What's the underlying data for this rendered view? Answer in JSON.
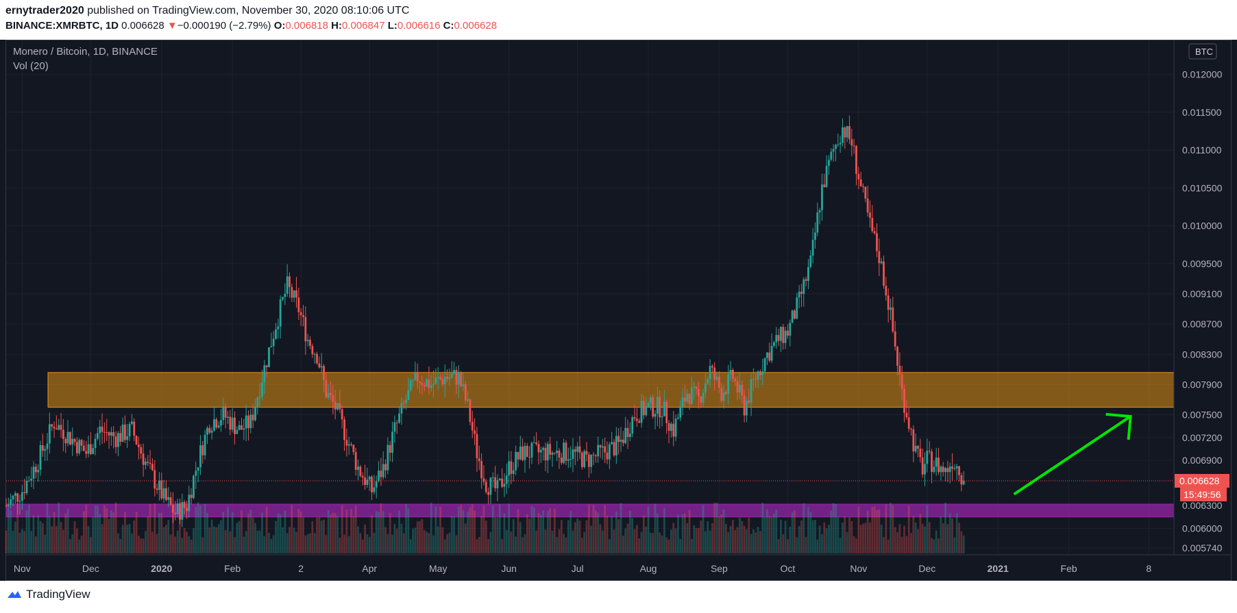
{
  "header": {
    "author": "ernytrader2020",
    "published_text": "published on TradingView.com, November 30, 2020 08:10:06 UTC",
    "symbol": "BINANCE:XMRBTC, 1D",
    "last": "0.006628",
    "change_arrow": "▼",
    "change": "−0.000190 (−2.79%)",
    "open_label": "O:",
    "open": "0.006818",
    "high_label": "H:",
    "high": "0.006847",
    "low_label": "L:",
    "low": "0.006616",
    "close_label": "C:",
    "close": "0.006628"
  },
  "legend": {
    "title": "Monero / Bitcoin, 1D, BINANCE",
    "volume": "Vol (20)"
  },
  "price_axis": {
    "currency_badge": "BTC",
    "last_price_label": "0.006628",
    "countdown_label": "15:49:56",
    "colors": {
      "up": "#26a69a",
      "down": "#ef5350"
    }
  },
  "footer": {
    "brand": "TradingView",
    "brand_icon": "tradingview-logo-icon"
  },
  "chart_data": {
    "type": "candlestick",
    "y_axis": {
      "ticks": [
        "0.012000",
        "0.011500",
        "0.011000",
        "0.010500",
        "0.010000",
        "0.009500",
        "0.009100",
        "0.008700",
        "0.008300",
        "0.007900",
        "0.007500",
        "0.007200",
        "0.006900",
        "0.006300",
        "0.006000",
        "0.005740"
      ],
      "tick_values": [
        0.012,
        0.0115,
        0.011,
        0.0105,
        0.01,
        0.0095,
        0.0091,
        0.0087,
        0.0083,
        0.0079,
        0.0075,
        0.0072,
        0.0069,
        0.0063,
        0.006,
        0.00574
      ],
      "range": [
        0.00565,
        0.01245
      ]
    },
    "x_axis": {
      "ticks": [
        {
          "label": "Nov",
          "date": "2019-11-01"
        },
        {
          "label": "Dec",
          "date": "2019-12-01"
        },
        {
          "label": "2020",
          "date": "2020-01-01",
          "bold": true
        },
        {
          "label": "Feb",
          "date": "2020-02-01"
        },
        {
          "label": "2",
          "date": "2020-03-02"
        },
        {
          "label": "Apr",
          "date": "2020-04-01"
        },
        {
          "label": "May",
          "date": "2020-05-01"
        },
        {
          "label": "Jun",
          "date": "2020-06-01"
        },
        {
          "label": "Jul",
          "date": "2020-07-01"
        },
        {
          "label": "Aug",
          "date": "2020-08-01"
        },
        {
          "label": "Sep",
          "date": "2020-09-01"
        },
        {
          "label": "Oct",
          "date": "2020-10-01"
        },
        {
          "label": "Nov",
          "date": "2020-11-01"
        },
        {
          "label": "Dec",
          "date": "2020-12-01"
        },
        {
          "label": "2021",
          "date": "2021-01-01",
          "bold": true
        },
        {
          "label": "Feb",
          "date": "2021-02-01"
        },
        {
          "label": "8",
          "date": "2021-03-08"
        }
      ],
      "range": [
        "2019-10-25",
        "2021-03-19"
      ]
    },
    "price_path": [
      [
        "2019-10-25",
        0.0063
      ],
      [
        "2019-11-01",
        0.0065
      ],
      [
        "2019-11-08",
        0.0069
      ],
      [
        "2019-11-15",
        0.0074
      ],
      [
        "2019-11-22",
        0.0072
      ],
      [
        "2019-11-29",
        0.007
      ],
      [
        "2019-12-05",
        0.0073
      ],
      [
        "2019-12-12",
        0.0072
      ],
      [
        "2019-12-19",
        0.0073
      ],
      [
        "2019-12-26",
        0.0068
      ],
      [
        "2020-01-02",
        0.0064
      ],
      [
        "2020-01-07",
        0.0062
      ],
      [
        "2020-01-12",
        0.0063
      ],
      [
        "2020-01-17",
        0.0069
      ],
      [
        "2020-01-22",
        0.0074
      ],
      [
        "2020-01-28",
        0.0075
      ],
      [
        "2020-02-04",
        0.0073
      ],
      [
        "2020-02-09",
        0.0074
      ],
      [
        "2020-02-14",
        0.008
      ],
      [
        "2020-02-20",
        0.0087
      ],
      [
        "2020-02-25",
        0.0092
      ],
      [
        "2020-03-01",
        0.0089
      ],
      [
        "2020-03-05",
        0.0085
      ],
      [
        "2020-03-09",
        0.0083
      ],
      [
        "2020-03-13",
        0.0078
      ],
      [
        "2020-03-17",
        0.0076
      ],
      [
        "2020-03-22",
        0.0072
      ],
      [
        "2020-03-27",
        0.0068
      ],
      [
        "2020-04-02",
        0.0065
      ],
      [
        "2020-04-07",
        0.0068
      ],
      [
        "2020-04-12",
        0.0073
      ],
      [
        "2020-04-17",
        0.0077
      ],
      [
        "2020-04-22",
        0.008
      ],
      [
        "2020-04-28",
        0.0079
      ],
      [
        "2020-05-04",
        0.008
      ],
      [
        "2020-05-10",
        0.008
      ],
      [
        "2020-05-14",
        0.0076
      ],
      [
        "2020-05-18",
        0.007
      ],
      [
        "2020-05-22",
        0.0066
      ],
      [
        "2020-05-27",
        0.0065
      ],
      [
        "2020-06-01",
        0.0068
      ],
      [
        "2020-06-07",
        0.007
      ],
      [
        "2020-06-14",
        0.007
      ],
      [
        "2020-06-21",
        0.007
      ],
      [
        "2020-06-28",
        0.007
      ],
      [
        "2020-07-05",
        0.0069
      ],
      [
        "2020-07-12",
        0.007
      ],
      [
        "2020-07-19",
        0.0071
      ],
      [
        "2020-07-26",
        0.0075
      ],
      [
        "2020-08-01",
        0.0076
      ],
      [
        "2020-08-07",
        0.0076
      ],
      [
        "2020-08-12",
        0.0073
      ],
      [
        "2020-08-18",
        0.0078
      ],
      [
        "2020-08-23",
        0.0077
      ],
      [
        "2020-08-28",
        0.0081
      ],
      [
        "2020-09-02",
        0.0078
      ],
      [
        "2020-09-07",
        0.008
      ],
      [
        "2020-09-12",
        0.0076
      ],
      [
        "2020-09-17",
        0.008
      ],
      [
        "2020-09-22",
        0.0083
      ],
      [
        "2020-09-27",
        0.0085
      ],
      [
        "2020-10-01",
        0.0086
      ],
      [
        "2020-10-06",
        0.009
      ],
      [
        "2020-10-11",
        0.0095
      ],
      [
        "2020-10-16",
        0.0105
      ],
      [
        "2020-10-21",
        0.011
      ],
      [
        "2020-10-25",
        0.0113
      ],
      [
        "2020-10-29",
        0.0111
      ],
      [
        "2020-11-02",
        0.0105
      ],
      [
        "2020-11-06",
        0.01
      ],
      [
        "2020-11-10",
        0.0096
      ],
      [
        "2020-11-14",
        0.009
      ],
      [
        "2020-11-17",
        0.0084
      ],
      [
        "2020-11-20",
        0.0078
      ],
      [
        "2020-11-23",
        0.0074
      ],
      [
        "2020-11-26",
        0.007
      ],
      [
        "2020-11-29",
        0.0068
      ],
      [
        "2020-12-01",
        0.0069
      ],
      [
        "2020-12-05",
        0.00685
      ],
      [
        "2020-12-09",
        0.00675
      ],
      [
        "2020-12-12",
        0.0069
      ],
      [
        "2020-12-15",
        0.0068
      ],
      [
        "2020-12-17",
        0.00663
      ]
    ],
    "zones": [
      {
        "name": "orange-resistance-zone",
        "from": 0.0076,
        "to": 0.00806,
        "color": "#f39c12",
        "opacity": 0.5
      },
      {
        "name": "purple-support-zone",
        "from": 0.00615,
        "to": 0.00632,
        "color": "#9c27b0",
        "opacity": 0.7
      }
    ],
    "last_price_line": 0.006628,
    "annotation": {
      "type": "arrow",
      "color": "#00e600",
      "from": [
        "2021-01-08",
        0.00645
      ],
      "to": [
        "2021-02-28",
        0.00748
      ]
    },
    "grid": true
  }
}
